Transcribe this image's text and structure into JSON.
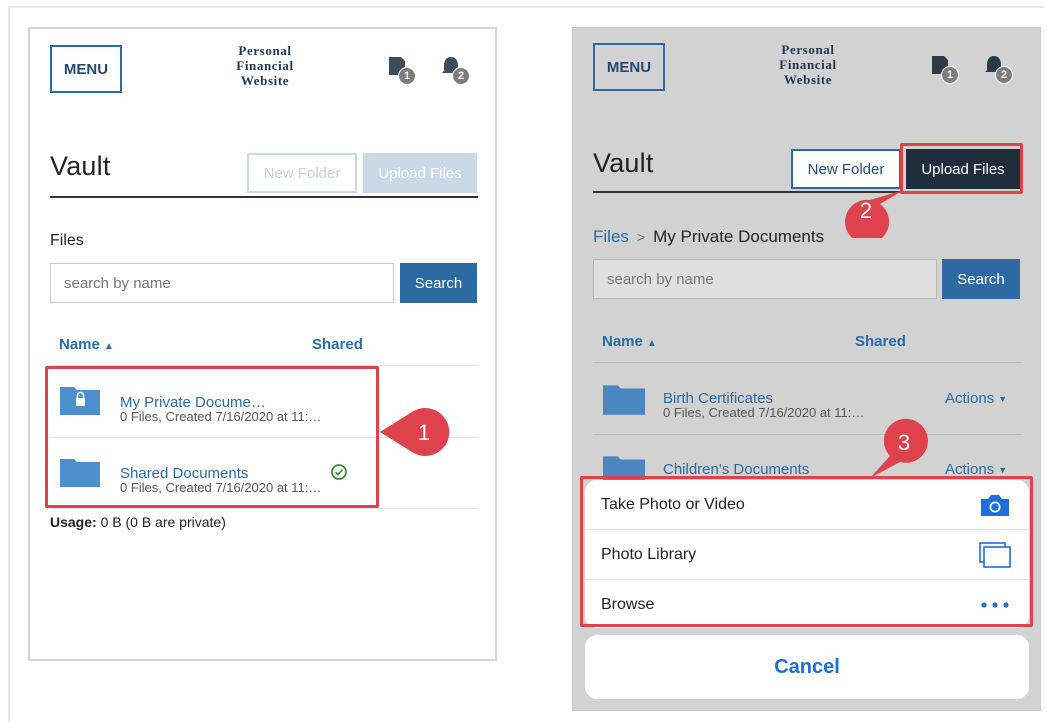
{
  "left_screen": {
    "header": {
      "menu_label": "MENU",
      "logo_line1": "Personal",
      "logo_line2": "Financial",
      "logo_line3": "Website",
      "notif1_count": "1",
      "notif2_count": "2"
    },
    "title": "Vault",
    "new_folder_label": "New Folder",
    "upload_label": "Upload Files",
    "section_label": "Files",
    "search_placeholder": "search by name",
    "search_button": "Search",
    "col_name": "Name",
    "col_shared": "Shared",
    "rows": [
      {
        "name": "My Private Docume…",
        "meta": "0 Files, Created 7/16/2020 at 11:…"
      },
      {
        "name": "Shared Documents",
        "meta": "0 Files, Created 7/16/2020 at 11:…"
      }
    ],
    "usage_label": "Usage:",
    "usage_value": "0 B (0 B are private)"
  },
  "right_screen": {
    "header": {
      "menu_label": "MENU",
      "logo_line1": "Personal",
      "logo_line2": "Financial",
      "logo_line3": "Website"
    },
    "title": "Vault",
    "new_folder_label": "New Folder",
    "upload_label": "Upload Files",
    "breadcrumb_root": "Files",
    "breadcrumb_sep": ">",
    "breadcrumb_current": "My Private Documents",
    "search_placeholder": "search by name",
    "search_button": "Search",
    "col_name": "Name",
    "col_shared": "Shared",
    "rows": [
      {
        "name": "Birth Certificates",
        "meta": "0 Files, Created 7/16/2020 at 11:…",
        "actions": "Actions"
      },
      {
        "name": "Children's Documents",
        "actions": "Actions"
      }
    ],
    "sheet_items": [
      "Take Photo or Video",
      "Photo Library",
      "Browse"
    ],
    "cancel_label": "Cancel"
  },
  "callouts": [
    "1",
    "2",
    "3"
  ],
  "colors": {
    "accent": "#2d6aa3",
    "annotation": "#e0424d",
    "dark_button": "#1f2d3c",
    "ios_blue": "#1f6fd9"
  }
}
